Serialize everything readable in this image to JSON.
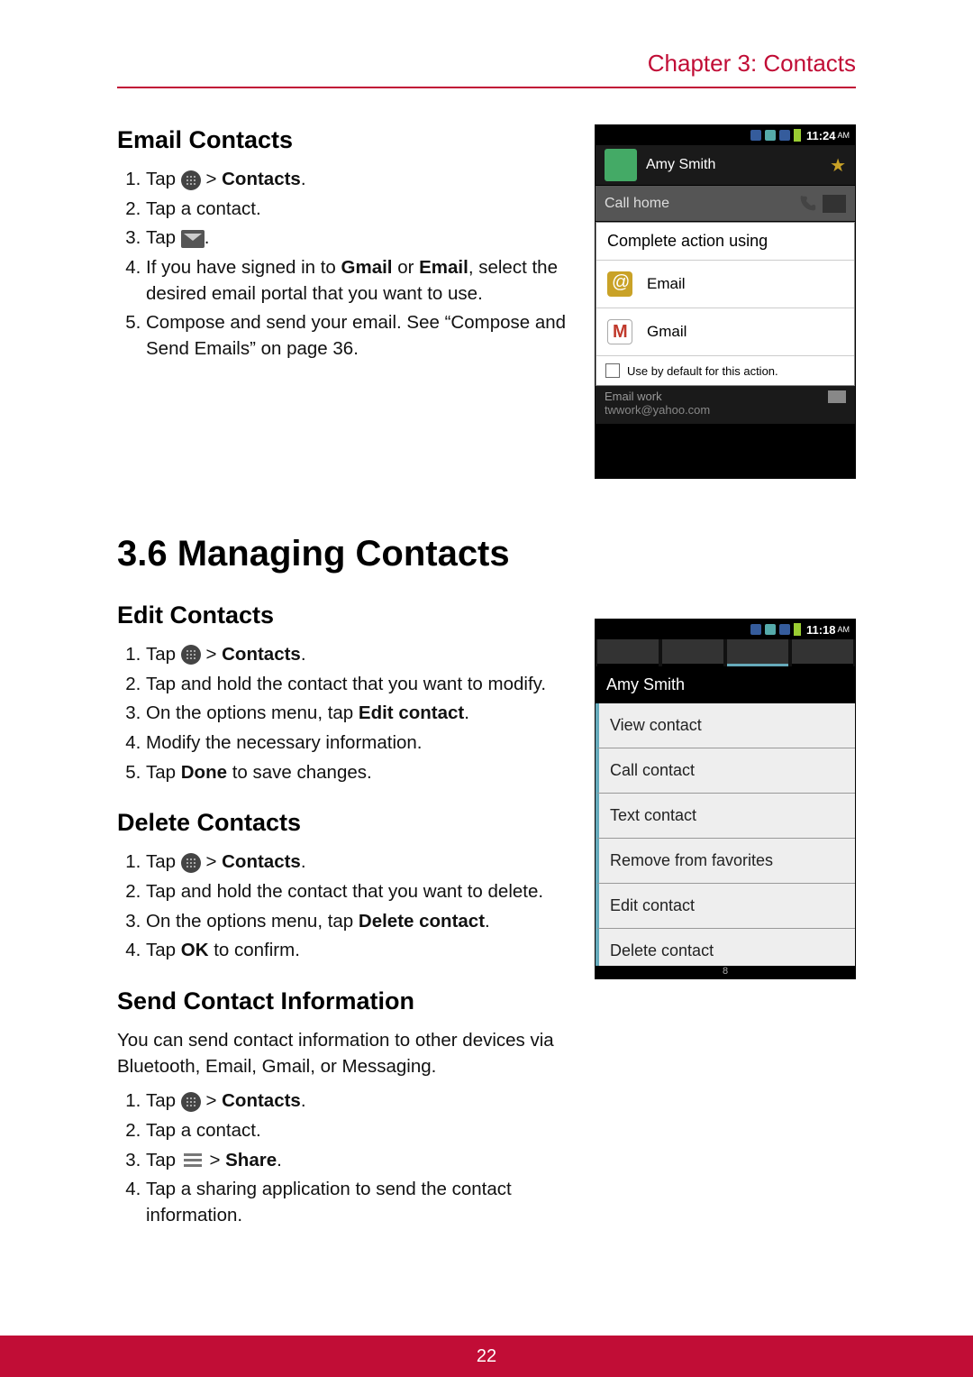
{
  "header": {
    "chapter": "Chapter 3: Contacts"
  },
  "section_email": {
    "title": "Email Contacts",
    "step1_a": "Tap ",
    "step1_b": "  > ",
    "step1_c": "Contacts",
    "step1_d": ".",
    "step2": "Tap a contact.",
    "step3_a": "Tap ",
    "step3_b": ".",
    "step4_a": "If you have signed in to ",
    "step4_b": "Gmail",
    "step4_c": " or ",
    "step4_d": "Email",
    "step4_e": ", select the desired email portal that you want to use.",
    "step5": "Compose and send your email. See “Compose and Send Emails” on page 36."
  },
  "main_heading": "3.6 Managing Contacts",
  "section_edit": {
    "title": "Edit Contacts",
    "s1a": "Tap ",
    "s1b": "  > ",
    "s1c": "Contacts",
    "s1d": ".",
    "s2": "Tap and hold the contact that you want to modify.",
    "s3a": "On the options menu, tap ",
    "s3b": "Edit contact",
    "s3c": ".",
    "s4": "Modify the necessary information.",
    "s5a": "Tap ",
    "s5b": "Done",
    "s5c": " to save changes."
  },
  "section_delete": {
    "title": "Delete Contacts",
    "s1a": "Tap ",
    "s1b": "  > ",
    "s1c": "Contacts",
    "s1d": ".",
    "s2": "Tap and hold the contact that you want to delete.",
    "s3a": "On the options menu, tap ",
    "s3b": "Delete contact",
    "s3c": ".",
    "s4a": "Tap ",
    "s4b": "OK",
    "s4c": " to confirm."
  },
  "section_send": {
    "title": "Send Contact Information",
    "intro": "You can send contact information to other devices via Bluetooth, Email, Gmail, or Messaging.",
    "s1a": "Tap ",
    "s1b": "  > ",
    "s1c": "Contacts",
    "s1d": ".",
    "s2": "Tap a contact.",
    "s3a": "Tap ",
    "s3b": " > ",
    "s3c": "Share",
    "s3d": ".",
    "s4": "Tap a sharing application to send the contact information."
  },
  "shot1": {
    "time": "11:24",
    "am": "AM",
    "name": "Amy Smith",
    "call": "Call home",
    "dialog_title": "Complete action using",
    "opt_email": "Email",
    "opt_gmail": "Gmail",
    "checkbox": "Use by default for this action.",
    "dim1": "Email work",
    "dim2": "twwork@yahoo.com"
  },
  "shot2": {
    "time": "11:18",
    "am": "AM",
    "name": "Amy Smith",
    "m1": "View contact",
    "m2": "Call contact",
    "m3": "Text contact",
    "m4": "Remove from favorites",
    "m5": "Edit contact",
    "m6": "Delete contact",
    "pn": "8"
  },
  "footer": {
    "page": "22"
  }
}
